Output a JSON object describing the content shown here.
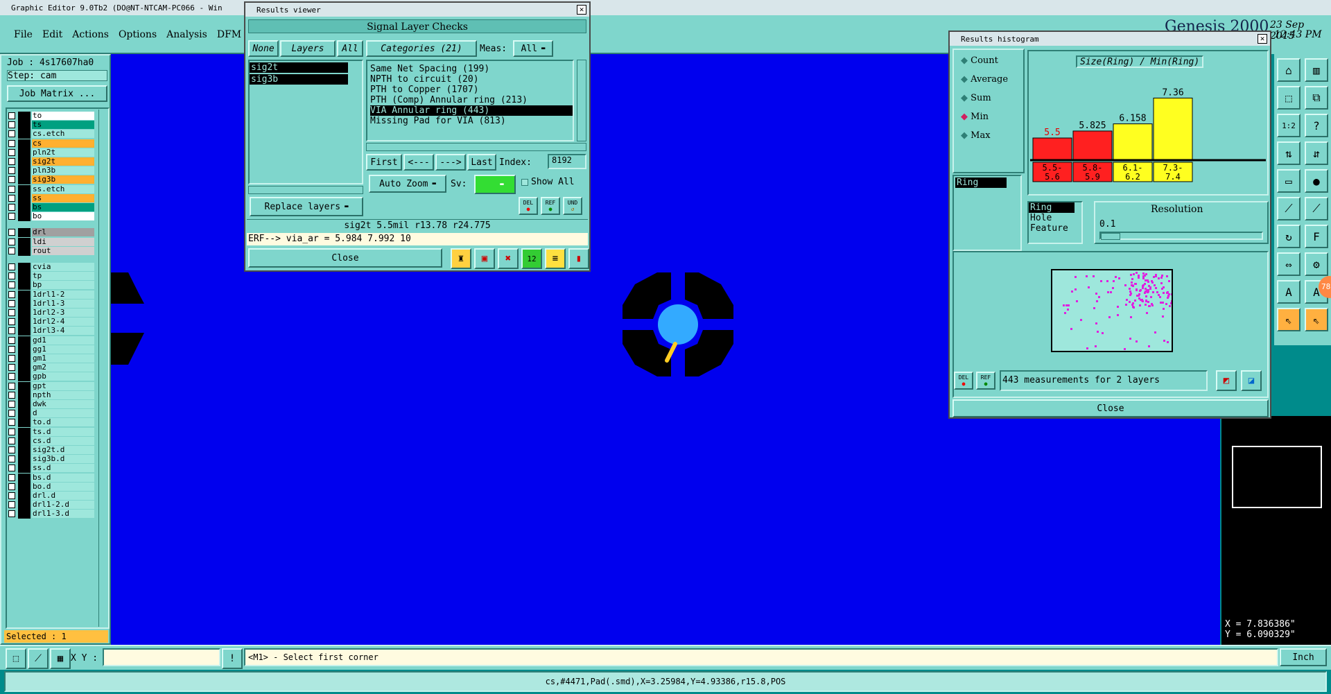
{
  "app": {
    "window_title": "Graphic Editor 9.0Tb2 (DO@NT-NTCAM-PC066 - Win",
    "brand": "Genesis 2000",
    "date": "23 Sep 2015",
    "time": "12:43 PM"
  },
  "menu": [
    "File",
    "Edit",
    "Actions",
    "Options",
    "Analysis",
    "DFM"
  ],
  "job": {
    "job_label": "Job : 4s17607ha0",
    "step_label": "Step: cam",
    "matrix_button": "Job Matrix ...",
    "selected": "Selected : 1"
  },
  "layers": [
    {
      "name": "to",
      "color": "#ffffff"
    },
    {
      "name": "ts",
      "color": "#00a080"
    },
    {
      "name": "cs.etch",
      "color": "#9ee7dc"
    },
    {
      "name": "cs",
      "color": "#ffb030"
    },
    {
      "name": "pln2t",
      "color": "#9ee7dc"
    },
    {
      "name": "sig2t",
      "color": "#ffb030"
    },
    {
      "name": "pln3b",
      "color": "#9ee7dc"
    },
    {
      "name": "sig3b",
      "color": "#ffb030"
    },
    {
      "name": "ss.etch",
      "color": "#9ee7dc"
    },
    {
      "name": "ss",
      "color": "#ffb030"
    },
    {
      "name": "bs",
      "color": "#00a080"
    },
    {
      "name": "bo",
      "color": "#ffffff"
    },
    {
      "name": "drl",
      "color": "#a0a0a0"
    },
    {
      "name": "ldi",
      "color": "#d0d0d0"
    },
    {
      "name": "rout",
      "color": "#d0d0d0"
    },
    {
      "name": "cvia",
      "color": "#9ee7dc"
    },
    {
      "name": "tp",
      "color": "#9ee7dc"
    },
    {
      "name": "bp",
      "color": "#9ee7dc"
    },
    {
      "name": "1drl1-2",
      "color": "#9ee7dc"
    },
    {
      "name": "1drl1-3",
      "color": "#9ee7dc"
    },
    {
      "name": "1drl2-3",
      "color": "#9ee7dc"
    },
    {
      "name": "1drl2-4",
      "color": "#9ee7dc"
    },
    {
      "name": "1drl3-4",
      "color": "#9ee7dc"
    },
    {
      "name": "gd1",
      "color": "#9ee7dc"
    },
    {
      "name": "gg1",
      "color": "#9ee7dc"
    },
    {
      "name": "gm1",
      "color": "#9ee7dc"
    },
    {
      "name": "gm2",
      "color": "#9ee7dc"
    },
    {
      "name": "gpb",
      "color": "#9ee7dc"
    },
    {
      "name": "gpt",
      "color": "#9ee7dc"
    },
    {
      "name": "npth",
      "color": "#9ee7dc"
    },
    {
      "name": "dwk",
      "color": "#9ee7dc"
    },
    {
      "name": "d",
      "color": "#9ee7dc"
    },
    {
      "name": "to.d",
      "color": "#9ee7dc"
    },
    {
      "name": "ts.d",
      "color": "#9ee7dc"
    },
    {
      "name": "cs.d",
      "color": "#9ee7dc"
    },
    {
      "name": "sig2t.d",
      "color": "#9ee7dc"
    },
    {
      "name": "sig3b.d",
      "color": "#9ee7dc"
    },
    {
      "name": "ss.d",
      "color": "#9ee7dc"
    },
    {
      "name": "bs.d",
      "color": "#9ee7dc"
    },
    {
      "name": "bo.d",
      "color": "#9ee7dc"
    },
    {
      "name": "drl.d",
      "color": "#9ee7dc"
    },
    {
      "name": "drl1-2.d",
      "color": "#9ee7dc"
    },
    {
      "name": "drl1-3.d",
      "color": "#9ee7dc"
    }
  ],
  "results_viewer": {
    "title": "Results viewer",
    "header": "Signal Layer Checks",
    "none": "None",
    "layers": "Layers",
    "all": "All",
    "categories_label": "Categories (21)",
    "meas_label": "Meas:",
    "meas_value": "All",
    "layer_list": [
      "sig2t",
      "sig3b"
    ],
    "categories": [
      "Same Net Spacing (199)",
      "NPTH to circuit (20)",
      "PTH to Copper (1707)",
      "PTH (Comp) Annular ring (213)",
      "VIA Annular ring (443)",
      "Missing Pad for VIA (813)"
    ],
    "nav": {
      "first": "First",
      "prev": "<---",
      "next": "--->",
      "last": "Last",
      "index_label": "Index:",
      "index_value": "8192"
    },
    "auto_zoom": "Auto Zoom",
    "sv_label": "Sv:",
    "show_all": "Show All",
    "replace_layers": "Replace layers",
    "info_line": "sig2t 5.5mil   r13.78   r24.775",
    "erf_line": "ERF--> via_ar = 5.984 7.992 10",
    "close": "Close",
    "small_btns": [
      "DEL",
      "REF",
      "UND"
    ]
  },
  "histogram": {
    "title": "Results histogram",
    "options": [
      "Count",
      "Average",
      "Sum",
      "Min",
      "Max"
    ],
    "selected_option": "Min",
    "field": "Ring",
    "heading": "Size(Ring) / Min(Ring)",
    "items": [
      "Ring",
      "Hole",
      "Feature"
    ],
    "resolution_label": "Resolution",
    "resolution_value": "0.1",
    "summary": "443 measurements for 2 layers",
    "close": "Close",
    "small_btns": [
      "DEL",
      "REF"
    ]
  },
  "chart_data": {
    "type": "bar",
    "title": "Size(Ring) / Min(Ring)",
    "categories": [
      "5.5-\n5.6",
      "5.8-\n5.9",
      "6.1-\n6.2",
      "7.3-\n7.4"
    ],
    "values": [
      5.5,
      5.825,
      6.158,
      7.36
    ],
    "labels": [
      "5.5",
      "5.825",
      "6.158",
      "7.36"
    ],
    "colors": [
      "#ff2020",
      "#ff2020",
      "#ffff20",
      "#ffff20"
    ],
    "ylim": [
      4.5,
      7.6
    ]
  },
  "bottom": {
    "xy_label": "X Y :",
    "prompt": "<M1> - Select first corner",
    "units": "Inch",
    "status": "cs,#4471,Pad(.smd),X=3.25984,Y=4.93386,r15.8,POS"
  },
  "coords": {
    "x": "X = 7.836386\"",
    "y": "Y = 6.090329\""
  },
  "badge": "78"
}
